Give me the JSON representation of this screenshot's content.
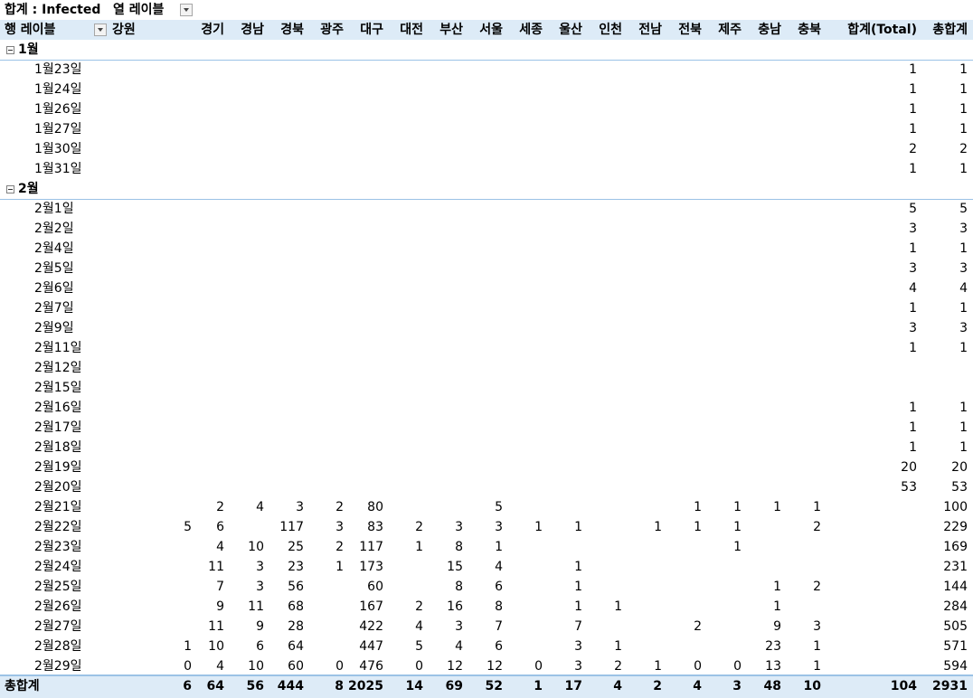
{
  "pivot": {
    "filter_label": "합계 : Infected",
    "col_labels_caption": "열 레이블",
    "row_labels_caption": "행 레이블",
    "columns": [
      "강원",
      "경기",
      "경남",
      "경북",
      "광주",
      "대구",
      "대전",
      "부산",
      "서울",
      "세종",
      "울산",
      "인천",
      "전남",
      "전북",
      "제주",
      "충남",
      "충북",
      "합계(Total)",
      "총합계"
    ],
    "groups": [
      {
        "label": "1월",
        "rows": [
          {
            "label": "1월23일",
            "cells": {
              "합계(Total)": "1",
              "총합계": "1"
            }
          },
          {
            "label": "1월24일",
            "cells": {
              "합계(Total)": "1",
              "총합계": "1"
            }
          },
          {
            "label": "1월26일",
            "cells": {
              "합계(Total)": "1",
              "총합계": "1"
            }
          },
          {
            "label": "1월27일",
            "cells": {
              "합계(Total)": "1",
              "총합계": "1"
            }
          },
          {
            "label": "1월30일",
            "cells": {
              "합계(Total)": "2",
              "총합계": "2"
            }
          },
          {
            "label": "1월31일",
            "cells": {
              "합계(Total)": "1",
              "총합계": "1"
            }
          }
        ]
      },
      {
        "label": "2월",
        "rows": [
          {
            "label": "2월1일",
            "cells": {
              "합계(Total)": "5",
              "총합계": "5"
            }
          },
          {
            "label": "2월2일",
            "cells": {
              "합계(Total)": "3",
              "총합계": "3"
            }
          },
          {
            "label": "2월4일",
            "cells": {
              "합계(Total)": "1",
              "총합계": "1"
            }
          },
          {
            "label": "2월5일",
            "cells": {
              "합계(Total)": "3",
              "총합계": "3"
            }
          },
          {
            "label": "2월6일",
            "cells": {
              "합계(Total)": "4",
              "총합계": "4"
            }
          },
          {
            "label": "2월7일",
            "cells": {
              "합계(Total)": "1",
              "총합계": "1"
            }
          },
          {
            "label": "2월9일",
            "cells": {
              "합계(Total)": "3",
              "총합계": "3"
            }
          },
          {
            "label": "2월11일",
            "cells": {
              "합계(Total)": "1",
              "총합계": "1"
            }
          },
          {
            "label": "2월12일",
            "cells": {}
          },
          {
            "label": "2월15일",
            "cells": {}
          },
          {
            "label": "2월16일",
            "cells": {
              "합계(Total)": "1",
              "총합계": "1"
            }
          },
          {
            "label": "2월17일",
            "cells": {
              "합계(Total)": "1",
              "총합계": "1"
            }
          },
          {
            "label": "2월18일",
            "cells": {
              "합계(Total)": "1",
              "총합계": "1"
            }
          },
          {
            "label": "2월19일",
            "cells": {
              "합계(Total)": "20",
              "총합계": "20"
            }
          },
          {
            "label": "2월20일",
            "cells": {
              "합계(Total)": "53",
              "총합계": "53"
            }
          },
          {
            "label": "2월21일",
            "cells": {
              "경기": "2",
              "경남": "4",
              "경북": "3",
              "광주": "2",
              "대구": "80",
              "서울": "5",
              "전북": "1",
              "제주": "1",
              "충남": "1",
              "충북": "1",
              "총합계": "100"
            }
          },
          {
            "label": "2월22일",
            "cells": {
              "강원": "5",
              "경기": "6",
              "경북": "117",
              "광주": "3",
              "대구": "83",
              "대전": "2",
              "부산": "3",
              "서울": "3",
              "세종": "1",
              "울산": "1",
              "전남": "1",
              "전북": "1",
              "제주": "1",
              "충북": "2",
              "총합계": "229"
            }
          },
          {
            "label": "2월23일",
            "cells": {
              "경기": "4",
              "경남": "10",
              "경북": "25",
              "광주": "2",
              "대구": "117",
              "대전": "1",
              "부산": "8",
              "서울": "1",
              "제주": "1",
              "총합계": "169"
            }
          },
          {
            "label": "2월24일",
            "cells": {
              "경기": "11",
              "경남": "3",
              "경북": "23",
              "광주": "1",
              "대구": "173",
              "부산": "15",
              "서울": "4",
              "울산": "1",
              "총합계": "231"
            }
          },
          {
            "label": "2월25일",
            "cells": {
              "경기": "7",
              "경남": "3",
              "경북": "56",
              "대구": "60",
              "부산": "8",
              "서울": "6",
              "울산": "1",
              "충남": "1",
              "충북": "2",
              "총합계": "144"
            }
          },
          {
            "label": "2월26일",
            "cells": {
              "경기": "9",
              "경남": "11",
              "경북": "68",
              "대구": "167",
              "대전": "2",
              "부산": "16",
              "서울": "8",
              "울산": "1",
              "인천": "1",
              "충남": "1",
              "총합계": "284"
            }
          },
          {
            "label": "2월27일",
            "cells": {
              "경기": "11",
              "경남": "9",
              "경북": "28",
              "대구": "422",
              "대전": "4",
              "부산": "3",
              "서울": "7",
              "울산": "7",
              "전북": "2",
              "충남": "9",
              "충북": "3",
              "총합계": "505"
            }
          },
          {
            "label": "2월28일",
            "cells": {
              "강원": "1",
              "경기": "10",
              "경남": "6",
              "경북": "64",
              "대구": "447",
              "대전": "5",
              "부산": "4",
              "서울": "6",
              "울산": "3",
              "인천": "1",
              "충남": "23",
              "충북": "1",
              "총합계": "571"
            }
          },
          {
            "label": "2월29일",
            "cells": {
              "강원": "0",
              "경기": "4",
              "경남": "10",
              "경북": "60",
              "광주": "0",
              "대구": "476",
              "대전": "0",
              "부산": "12",
              "서울": "12",
              "세종": "0",
              "울산": "3",
              "인천": "2",
              "전남": "1",
              "전북": "0",
              "제주": "0",
              "충남": "13",
              "충북": "1",
              "총합계": "594"
            }
          }
        ]
      }
    ],
    "grand_total": {
      "label": "총합계",
      "cells": {
        "강원": "6",
        "경기": "64",
        "경남": "56",
        "경북": "444",
        "광주": "8",
        "대구": "2025",
        "대전": "14",
        "부산": "69",
        "서울": "52",
        "세종": "1",
        "울산": "17",
        "인천": "4",
        "전남": "2",
        "전북": "4",
        "제주": "3",
        "충남": "48",
        "충북": "10",
        "합계(Total)": "104",
        "총합계": "2931"
      }
    }
  }
}
